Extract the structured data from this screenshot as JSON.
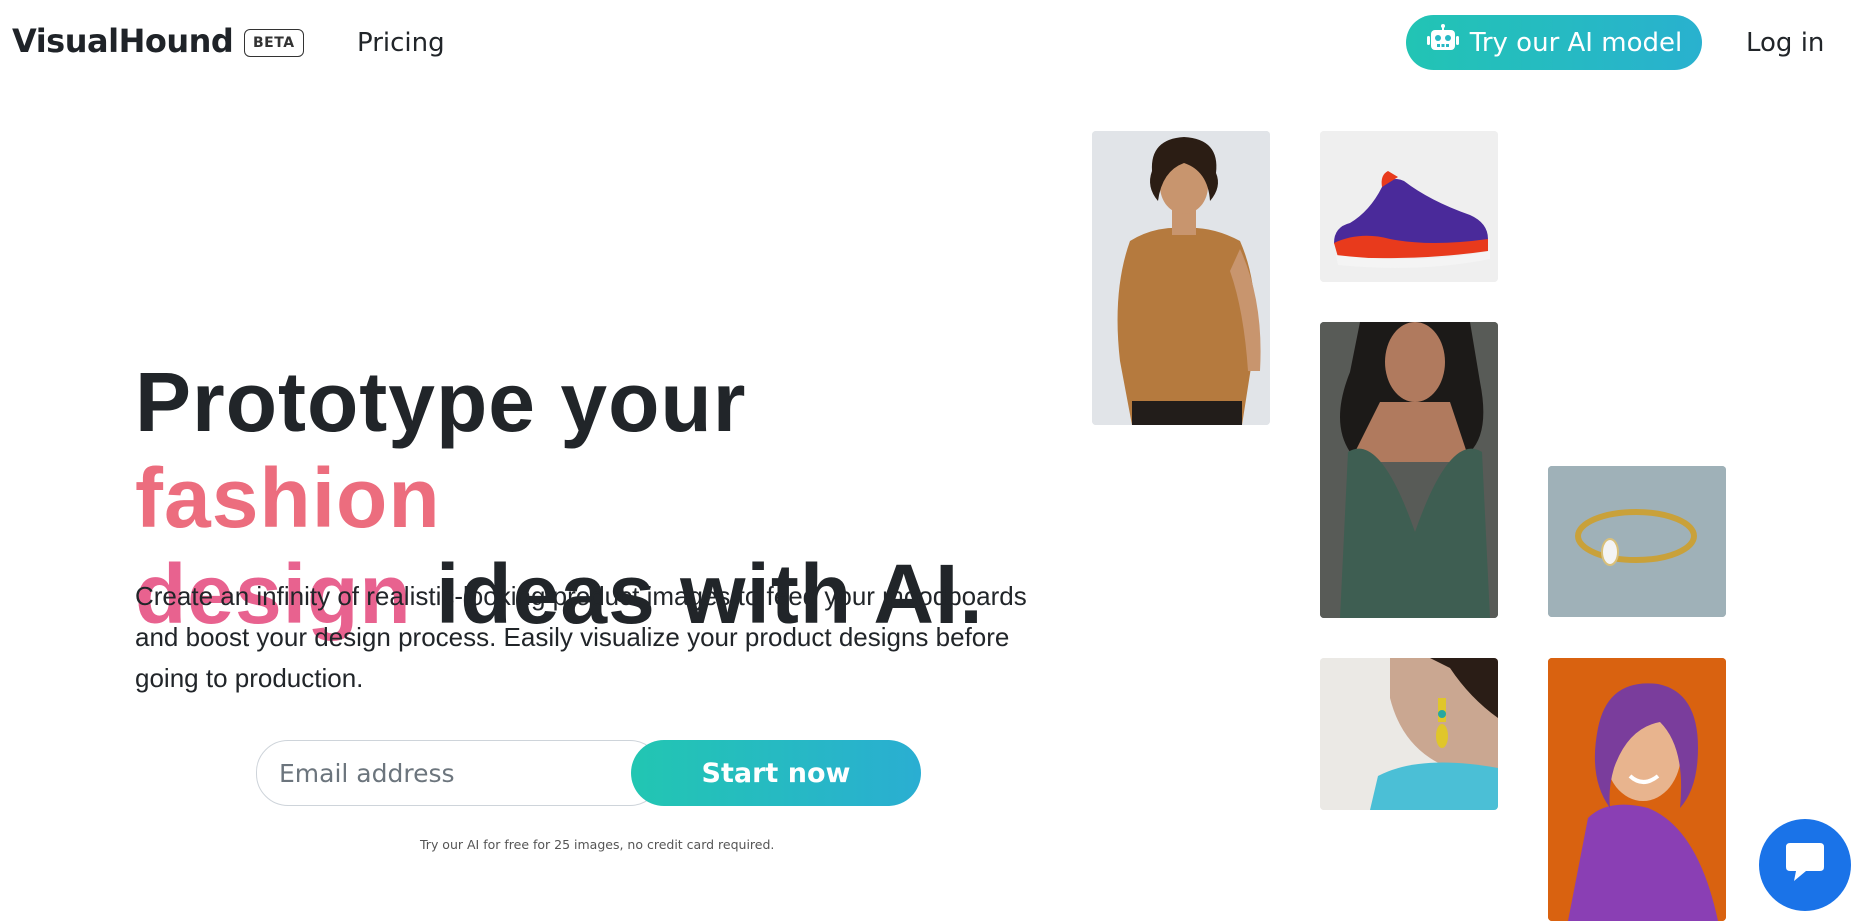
{
  "nav": {
    "logo": "VisualHound",
    "badge": "BETA",
    "pricing": "Pricing",
    "try_button": "Try our AI model",
    "login": "Log in"
  },
  "hero": {
    "headline_part1": "Prototype your ",
    "headline_fashion": "fashion",
    "headline_design": "design",
    "headline_part2": " ideas with AI.",
    "subtext": "Create an infinity of realistic-looking product images to feed your moodboards and boost your design process. Easily visualize your product designs before going to production.",
    "email_placeholder": "Email address",
    "start_button": "Start now",
    "note": "Try our AI for free for 25 images, no credit card required."
  },
  "colors": {
    "accent_teal": "#22c4b4",
    "accent_blue": "#29b1cf",
    "headline_coral": "#ec6d7e",
    "headline_pink": "#e8628f",
    "chat_blue": "#1a73e8"
  },
  "icons": {
    "try_button": "robot-icon",
    "chat": "chat-bubble-icon"
  }
}
